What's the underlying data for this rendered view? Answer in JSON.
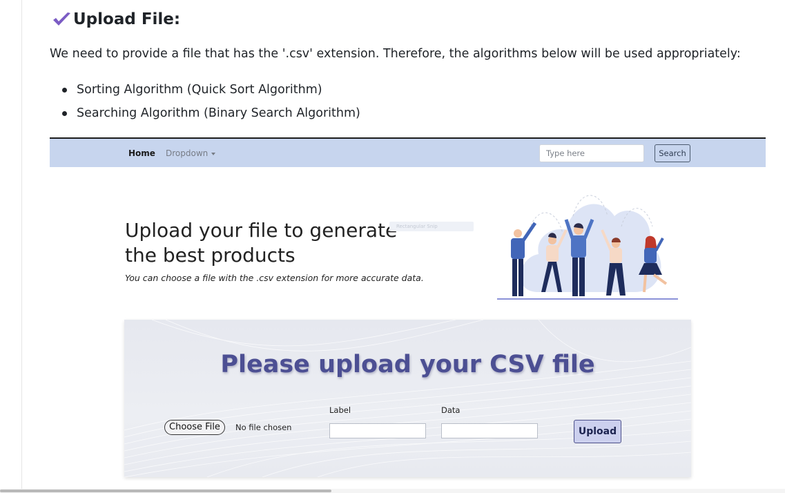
{
  "doc": {
    "heading": "Upload File:",
    "paragraph": "We need to provide a file that has the '.csv' extension. Therefore, the algorithms below will be used appropriately:",
    "list": [
      "Sorting Algorithm (Quick Sort Algorithm)",
      "Searching Algorithm (Binary Search Algorithm)"
    ]
  },
  "navbar": {
    "home": "Home",
    "dropdown": "Dropdown",
    "search_placeholder": "Type here",
    "search_button": "Search"
  },
  "hero": {
    "title": "Upload your file to generate the best products",
    "subtitle": "You can choose a file with the .csv extension for more accurate data.",
    "ghost_chip": "Rectangular Snip"
  },
  "upload_card": {
    "title": "Please upload your CSV file",
    "choose_file": "Choose File",
    "no_file": "No file chosen",
    "label_field_label": "Label",
    "data_field_label": "Data",
    "upload_button": "Upload"
  },
  "colors": {
    "navbar_bg": "#c7d5ee",
    "card_title": "#4c4f93",
    "check_icon": "#7b5cc4",
    "upload_button_bg": "#ccd0ee"
  },
  "icons": [
    "check-mark-icon",
    "caret-down-icon",
    "people-celebrating-illustration"
  ]
}
